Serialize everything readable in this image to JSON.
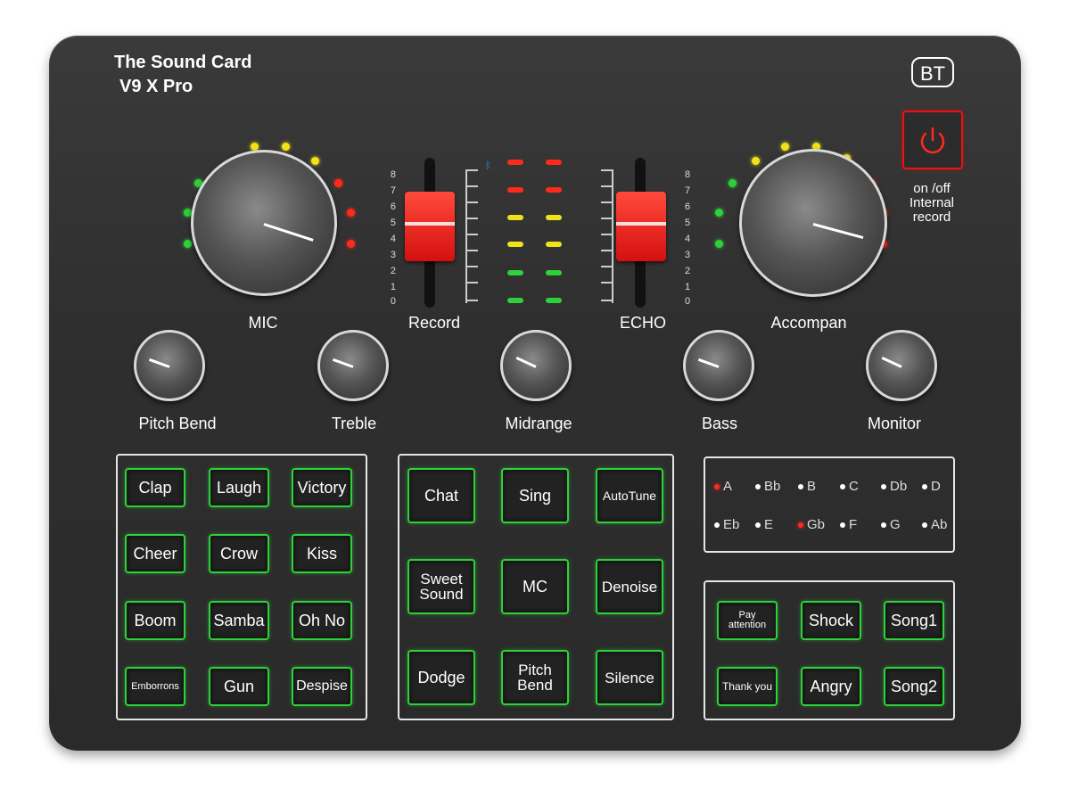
{
  "brand": {
    "line1": "The Sound Card",
    "line2": "V9 X Pro"
  },
  "bt_label": "BT",
  "power": {
    "icon": "power-icon",
    "label": "on /off\nInternal\nrecord",
    "color": "#ff1a1a"
  },
  "knobs": {
    "mic": "MIC",
    "accompan": "Accompan",
    "pitch_bend": "Pitch Bend",
    "treble": "Treble",
    "midrange": "Midrange",
    "bass": "Bass",
    "monitor": "Monitor"
  },
  "faders": {
    "record": "Record",
    "echo": "ECHO",
    "scale": [
      "8",
      "7",
      "6",
      "5",
      "4",
      "3",
      "2",
      "1",
      "0"
    ]
  },
  "effects_left": [
    [
      "Clap",
      "Laugh",
      "Victory"
    ],
    [
      "Cheer",
      "Crow",
      "Kiss"
    ],
    [
      "Boom",
      "Samba",
      "Oh No"
    ],
    [
      "Emborrons",
      "Gun",
      "Despise"
    ]
  ],
  "effects_mid": [
    [
      "Chat",
      "Sing",
      "AutoTune"
    ],
    [
      "Sweet\nSound",
      "MC",
      "Denoise"
    ],
    [
      "Dodge",
      "Pitch\nBend",
      "Silence"
    ]
  ],
  "keys": {
    "row1": [
      {
        "n": "A",
        "on": true
      },
      {
        "n": "Bb",
        "on": false
      },
      {
        "n": "B",
        "on": false
      },
      {
        "n": "C",
        "on": false
      },
      {
        "n": "Db",
        "on": false
      },
      {
        "n": "D",
        "on": false
      }
    ],
    "row2": [
      {
        "n": "Eb",
        "on": false
      },
      {
        "n": "E",
        "on": false
      },
      {
        "n": "Gb",
        "on": true
      },
      {
        "n": "F",
        "on": false
      },
      {
        "n": "G",
        "on": false
      },
      {
        "n": "Ab",
        "on": false
      }
    ]
  },
  "effects_right": [
    [
      "Pay\nattention",
      "Shock",
      "Song1"
    ],
    [
      "Thank you",
      "Angry",
      "Song2"
    ]
  ],
  "colors": {
    "accent_green": "#2ed13a",
    "accent_red": "#ff1a1a",
    "body": "#2f2f2f"
  }
}
